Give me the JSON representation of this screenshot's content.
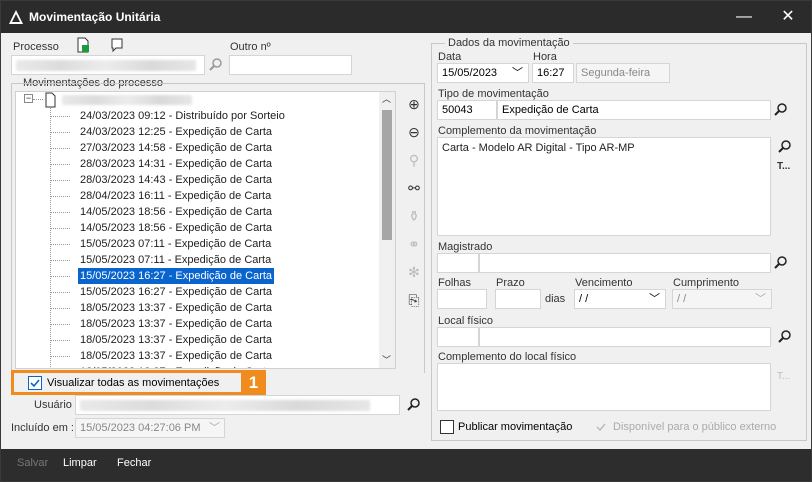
{
  "window": {
    "title": "Movimentação Unitária",
    "minimize": "—",
    "close": "✕"
  },
  "process": {
    "label": "Processo",
    "other_label": "Outro nº",
    "movements_label": "Movimentações do processo",
    "entries": [
      "24/03/2023 09:12 - Distribuído por Sorteio",
      "24/03/2023 12:25 - Expedição de Carta",
      "27/03/2023 14:58 - Expedição de Carta",
      "28/03/2023 14:31 - Expedição de Carta",
      "28/03/2023 14:43 - Expedição de Carta",
      "28/04/2023 16:11 - Expedição de Carta",
      "14/05/2023 18:56 - Expedição de Carta",
      "14/05/2023 18:56 - Expedição de Carta",
      "15/05/2023 07:11 - Expedição de Carta",
      "15/05/2023 07:11 - Expedição de Carta",
      "15/05/2023 16:27 - Expedição de Carta",
      "15/05/2023 16:27 - Expedição de Carta",
      "18/05/2023 13:37 - Expedição de Carta",
      "18/05/2023 13:37 - Expedição de Carta",
      "18/05/2023 13:37 - Expedição de Carta",
      "18/05/2023 13:37 - Expedição de Carta",
      "18/05/2023 13:37 - Expedição de Carta"
    ],
    "selected_index": 10,
    "view_all_label": "Visualizar todas as movimentações",
    "view_all_checked": true,
    "user_label": "Usuário",
    "included_label": "Incluído em :",
    "included_value": "15/05/2023 04:27:06 PM"
  },
  "details": {
    "group_title": "Dados da movimentação",
    "date_label": "Data",
    "date_value": "15/05/2023",
    "time_label": "Hora",
    "time_value": "16:27",
    "weekday": "Segunda-feira",
    "type_label": "Tipo de movimentação",
    "type_code": "50043",
    "type_name": "Expedição de Carta",
    "complement_label": "Complemento da movimentação",
    "complement_value": "Carta - Modelo AR Digital - Tipo AR-MP",
    "t_label": "T...",
    "magistrate_label": "Magistrado",
    "folhas_label": "Folhas",
    "prazo_label": "Prazo",
    "dias_label": "dias",
    "vencimento_label": "Vencimento",
    "vencimento_value": "/ /",
    "cumprimento_label": "Cumprimento",
    "cumprimento_value": "/ /",
    "local_label": "Local físico",
    "local_complement_label": "Complemento do local físico",
    "publish_label": "Publicar movimentação",
    "public_label": "Disponível para o público externo"
  },
  "footer": {
    "save": "Salvar",
    "clear": "Limpar",
    "close": "Fechar"
  },
  "annotation": {
    "badge": "1",
    "color": "#f08c1e"
  }
}
